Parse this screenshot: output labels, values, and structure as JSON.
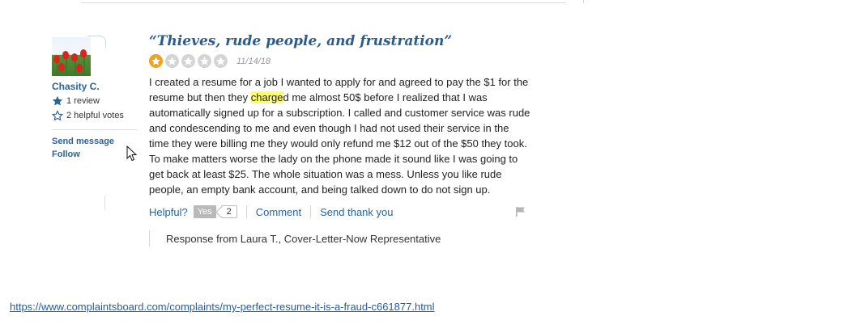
{
  "author": {
    "name": "Chasity C.",
    "reviews": "1 review",
    "helpful_votes": "2 helpful votes",
    "send_message": "Send message",
    "follow": "Follow"
  },
  "review": {
    "title": "“Thieves, rude people, and frustration”",
    "rating": 1,
    "rating_max": 5,
    "date": "11/14/18",
    "body_before": "I created a resume for a job I wanted to apply for and agreed to pay the $1 for the resume but then they ",
    "body_highlight": "charge",
    "body_after": "d me almost 50$ before I realized that I was automatically signed up for a subscription. I called and customer service was rude and condescending to me and even though I had not used their service in the time they were billing me they would only refund me $12 out of the $50 they took. To make matters worse the lady on the phone made it sound like I was going to get back at least $25. The whole situation was a mess. Unless you like rude people, an empty bank account, and being talked down to do not sign up."
  },
  "actions": {
    "helpful_label": "Helpful?",
    "yes_label": "Yes",
    "yes_count": "2",
    "comment_label": "Comment",
    "thank_label": "Send thank you"
  },
  "response": {
    "text": "Response from Laura T., Cover-Letter-Now Representative"
  },
  "source_url": "https://www.complaintsboard.com/complaints/my-perfect-resume-it-is-a-fraud-c661877.html",
  "colors": {
    "link": "#2a6496",
    "title": "#2a5d8f",
    "star_active": "#f0a11f",
    "star_inactive": "#d4d4d4",
    "highlight": "#ffff66"
  }
}
